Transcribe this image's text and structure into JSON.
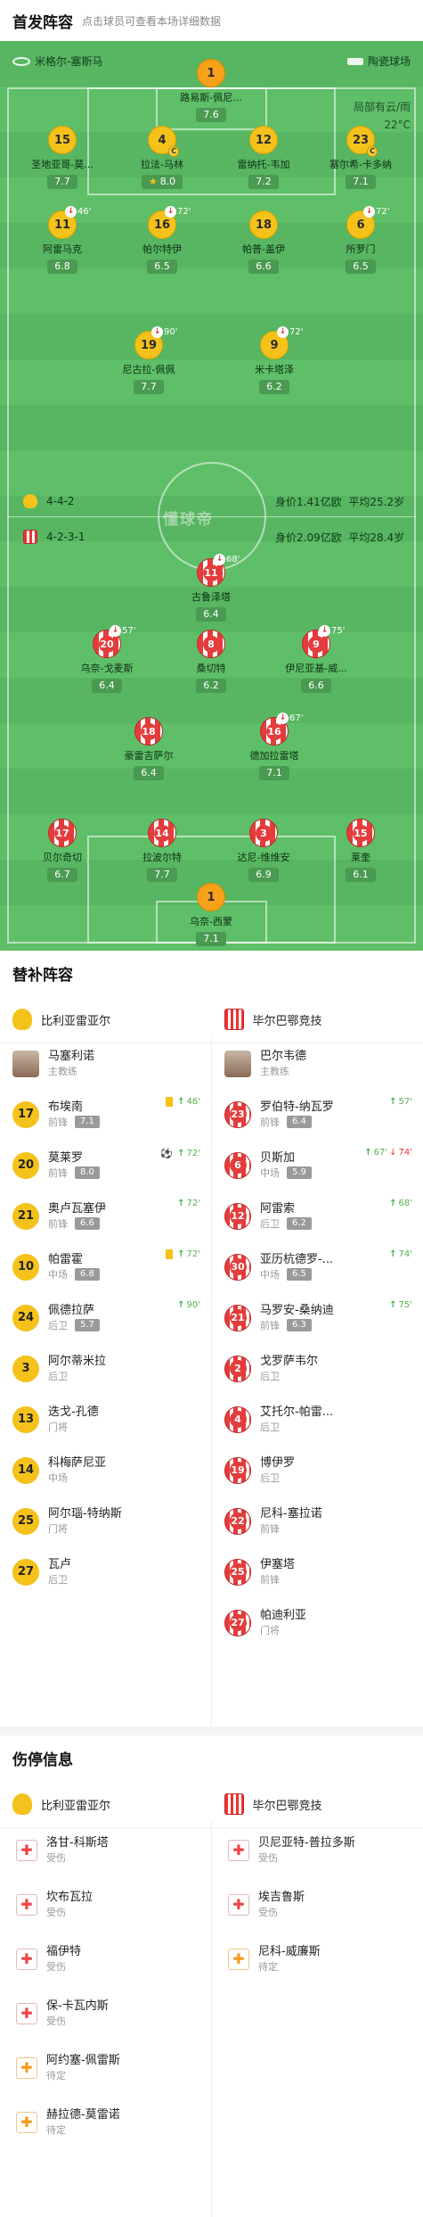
{
  "lineup": {
    "title": "首发阵容",
    "subtitle": "点击球员可查看本场详细数据"
  },
  "venue": {
    "stadium": "米格尔-塞斯马",
    "surface": "陶瓷球场",
    "weather": "局部有云/雨",
    "temp": "22°C"
  },
  "home": {
    "formation": "4-4-2",
    "value": "身价1.41亿欧",
    "age": "平均25.2岁"
  },
  "away": {
    "formation": "4-2-3-1",
    "value": "身价2.09亿欧",
    "age": "平均28.4岁"
  },
  "watermark": "懂球帝",
  "pitch_players": [
    {
      "num": "1",
      "name": "路易斯-佩尼...",
      "rating": "7.6",
      "team": "o"
    },
    {
      "num": "15",
      "name": "圣地亚哥-莫...",
      "rating": "7.7",
      "team": "y"
    },
    {
      "num": "4",
      "name": "拉法-马林",
      "rating": "8.0",
      "team": "y",
      "star": "1"
    },
    {
      "num": "12",
      "name": "雷纳托-韦加",
      "rating": "7.2",
      "team": "y"
    },
    {
      "num": "23",
      "name": "塞尔希-卡多纳",
      "rating": "7.1",
      "team": "y"
    },
    {
      "num": "11",
      "name": "阿雷马克",
      "rating": "6.8",
      "team": "y",
      "sub": "46'"
    },
    {
      "num": "16",
      "name": "帕尔特伊",
      "rating": "6.5",
      "team": "y",
      "sub": "72'"
    },
    {
      "num": "18",
      "name": "帕普-盖伊",
      "rating": "6.6",
      "team": "y"
    },
    {
      "num": "6",
      "name": "所罗门",
      "rating": "6.5",
      "team": "y",
      "sub": "72'"
    },
    {
      "num": "19",
      "name": "尼古拉-佩佩",
      "rating": "7.7",
      "team": "y",
      "sub": "90'"
    },
    {
      "num": "9",
      "name": "米卡塔泽",
      "rating": "6.2",
      "team": "y",
      "sub": "72'"
    },
    {
      "num": "11",
      "name": "古鲁泽塔",
      "rating": "6.4",
      "team": "r",
      "sub": "68'"
    },
    {
      "num": "20",
      "name": "乌奈-戈麦斯",
      "rating": "6.4",
      "team": "r",
      "sub": "57'"
    },
    {
      "num": "8",
      "name": "桑切特",
      "rating": "6.2",
      "team": "r"
    },
    {
      "num": "9",
      "name": "伊尼亚基-威...",
      "rating": "6.6",
      "team": "r",
      "sub": "75'"
    },
    {
      "num": "18",
      "name": "豪雷吉萨尔",
      "rating": "6.4",
      "team": "r"
    },
    {
      "num": "16",
      "name": "德加拉雷塔",
      "rating": "7.1",
      "team": "r",
      "sub": "67'"
    },
    {
      "num": "17",
      "name": "贝尔奇切",
      "rating": "6.7",
      "team": "r"
    },
    {
      "num": "14",
      "name": "拉波尔特",
      "rating": "7.7",
      "team": "r"
    },
    {
      "num": "3",
      "name": "达尼-维维安",
      "rating": "6.9",
      "team": "r"
    },
    {
      "num": "15",
      "name": "莱奎",
      "rating": "6.1",
      "team": "r"
    },
    {
      "num": "1",
      "name": "乌奈-西蒙",
      "rating": "7.1",
      "team": "o"
    }
  ],
  "subs": {
    "title": "替补阵容",
    "home_team": "比利亚雷亚尔",
    "away_team": "毕尔巴鄂竞技",
    "home": [
      {
        "name": "马塞利诺",
        "pos": "主教练",
        "coach": true
      },
      {
        "num": "17",
        "name": "布埃南",
        "pos": "前锋",
        "score": "7.1",
        "yc": true,
        "in": "46'"
      },
      {
        "num": "20",
        "name": "莫莱罗",
        "pos": "前锋",
        "score": "8.0",
        "ball": true,
        "in": "72'"
      },
      {
        "num": "21",
        "name": "奥卢瓦塞伊",
        "pos": "前锋",
        "score": "6.6",
        "in": "72'"
      },
      {
        "num": "10",
        "name": "帕雷霍",
        "pos": "中场",
        "score": "6.8",
        "yc": true,
        "in": "72'"
      },
      {
        "num": "24",
        "name": "佩德拉萨",
        "pos": "后卫",
        "score": "5.7",
        "in": "90'"
      },
      {
        "num": "3",
        "name": "阿尔蒂米拉",
        "pos": "后卫"
      },
      {
        "num": "13",
        "name": "迭戈-孔德",
        "pos": "门将"
      },
      {
        "num": "14",
        "name": "科梅萨尼亚",
        "pos": "中场"
      },
      {
        "num": "25",
        "name": "阿尔瑙-特纳斯",
        "pos": "门将"
      },
      {
        "num": "27",
        "name": "瓦卢",
        "pos": "后卫"
      }
    ],
    "away": [
      {
        "name": "巴尔韦德",
        "pos": "主教练",
        "coach": true
      },
      {
        "num": "23",
        "name": "罗伯特-纳瓦罗",
        "pos": "前锋",
        "score": "6.4",
        "in": "57'"
      },
      {
        "num": "6",
        "name": "贝斯加",
        "pos": "中场",
        "score": "5.9",
        "in": "67'",
        "out": "74'"
      },
      {
        "num": "12",
        "name": "阿雷索",
        "pos": "后卫",
        "score": "6.2",
        "in": "68'"
      },
      {
        "num": "30",
        "name": "亚历杭德罗-...",
        "pos": "中场",
        "score": "6.5",
        "in": "74'"
      },
      {
        "num": "21",
        "name": "马罗安-桑纳迪",
        "pos": "前锋",
        "score": "6.3",
        "in": "75'"
      },
      {
        "num": "2",
        "name": "戈罗萨韦尔",
        "pos": "后卫"
      },
      {
        "num": "4",
        "name": "艾托尔-帕雷...",
        "pos": "后卫"
      },
      {
        "num": "19",
        "name": "博伊罗",
        "pos": "后卫"
      },
      {
        "num": "22",
        "name": "尼科-塞拉诺",
        "pos": "前锋"
      },
      {
        "num": "25",
        "name": "伊塞塔",
        "pos": "前锋"
      },
      {
        "num": "27",
        "name": "帕迪利亚",
        "pos": "门将"
      }
    ]
  },
  "injury": {
    "title": "伤停信息",
    "home_team": "比利亚雷亚尔",
    "away_team": "毕尔巴鄂竞技",
    "home": [
      {
        "name": "洛甘-科斯塔",
        "status": "受伤"
      },
      {
        "name": "坎布瓦拉",
        "status": "受伤"
      },
      {
        "name": "福伊特",
        "status": "受伤"
      },
      {
        "name": "保-卡瓦内斯",
        "status": "受伤"
      },
      {
        "name": "阿约塞-佩雷斯",
        "status": "待定",
        "q": true
      },
      {
        "name": "赫拉德-莫雷诺",
        "status": "待定",
        "q": true
      }
    ],
    "away": [
      {
        "name": "贝尼亚特-普拉多斯",
        "status": "受伤"
      },
      {
        "name": "埃吉鲁斯",
        "status": "受伤"
      },
      {
        "name": "尼科-威廉斯",
        "status": "待定",
        "q": true
      }
    ]
  }
}
